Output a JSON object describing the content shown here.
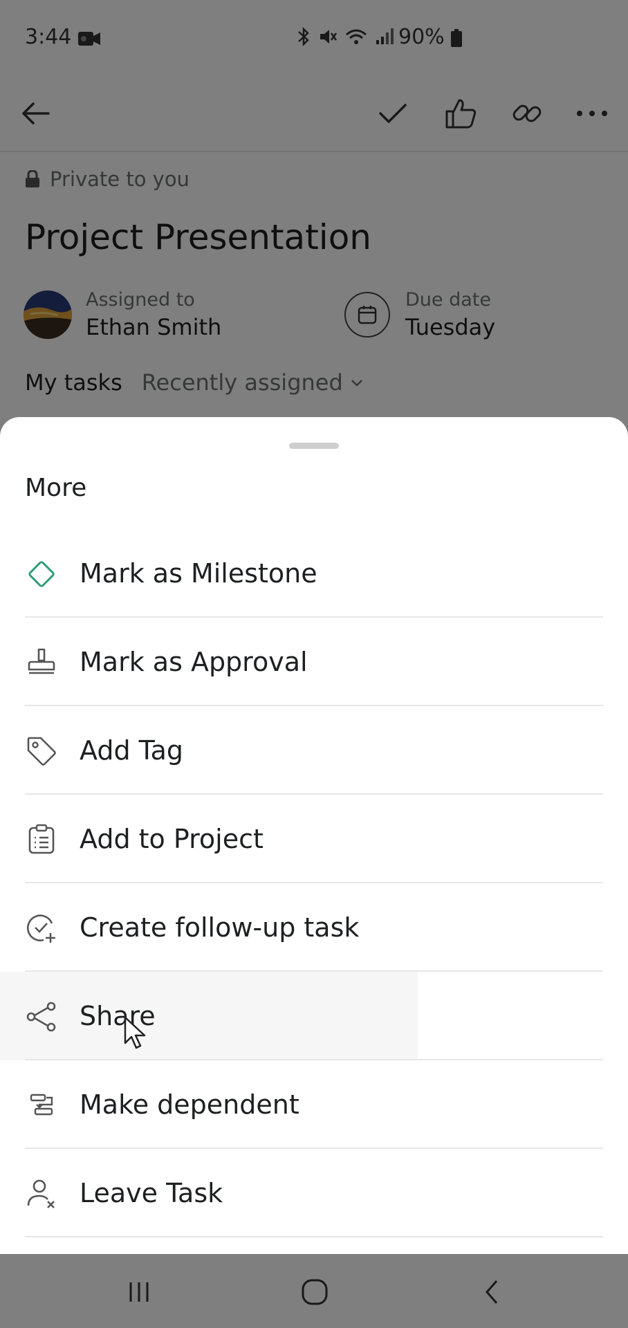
{
  "status_bar": {
    "time": "3:44",
    "battery": "90%"
  },
  "task": {
    "privacy": "Private to you",
    "title": "Project Presentation",
    "assigned_label": "Assigned to",
    "assignee": "Ethan Smith",
    "due_label": "Due date",
    "due_value": "Tuesday",
    "project": "My tasks",
    "section": "Recently assigned"
  },
  "sheet": {
    "title": "More",
    "items": [
      {
        "label": "Mark as Milestone",
        "icon": "milestone-diamond-icon"
      },
      {
        "label": "Mark as Approval",
        "icon": "approval-stamp-icon"
      },
      {
        "label": "Add Tag",
        "icon": "tag-icon"
      },
      {
        "label": "Add to Project",
        "icon": "clipboard-list-icon"
      },
      {
        "label": "Create follow-up task",
        "icon": "follow-up-check-icon"
      },
      {
        "label": "Share",
        "icon": "share-icon"
      },
      {
        "label": "Make dependent",
        "icon": "dependency-icon"
      },
      {
        "label": "Leave Task",
        "icon": "leave-user-icon"
      }
    ]
  },
  "colors": {
    "milestone_accent": "#2f9e74",
    "scrim": "rgba(0,0,0,0.5)"
  }
}
